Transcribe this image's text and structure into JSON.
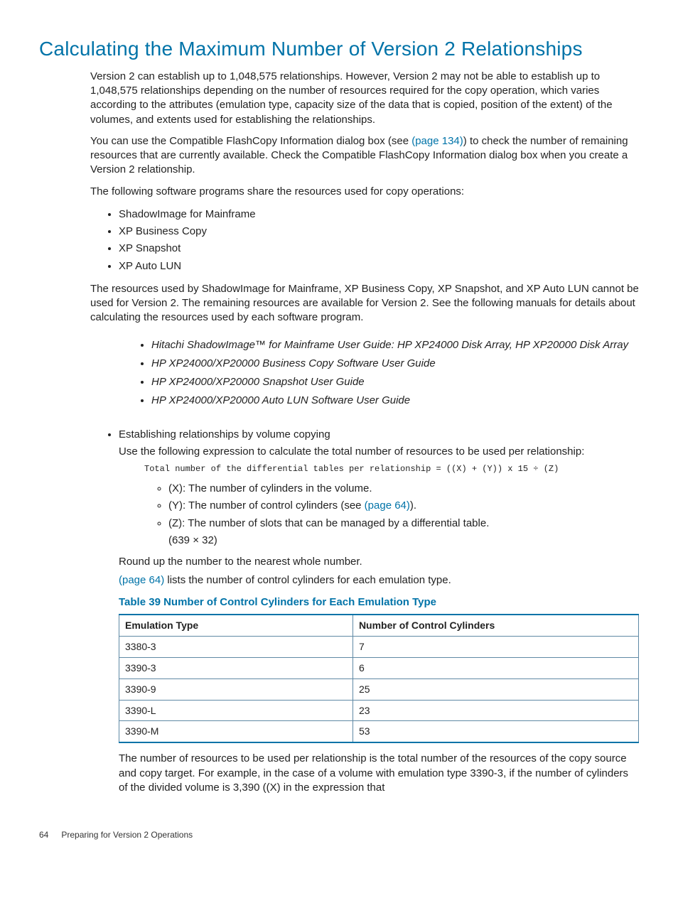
{
  "heading": "Calculating the Maximum Number of Version 2 Relationships",
  "p1": "Version 2 can establish up to 1,048,575 relationships. However, Version 2 may not be able to establish up to 1,048,575 relationships depending on the number of resources required for the copy operation, which varies according to the attributes (emulation type, capacity size of the data that is copied, position of the extent) of the volumes, and extents used for establishing the relationships.",
  "p2a": "You can use the Compatible FlashCopy Information dialog box (see ",
  "p2_link": "(page 134)",
  "p2b": ") to check the number of remaining resources that are currently available. Check the Compatible FlashCopy Information dialog box when you create a Version 2 relationship.",
  "p3": "The following software programs share the resources used for copy operations:",
  "bullets1": {
    "0": "ShadowImage for Mainframe",
    "1": "XP Business Copy",
    "2": "XP Snapshot",
    "3": "XP Auto LUN"
  },
  "p4": "The resources used by ShadowImage for Mainframe, XP Business Copy, XP Snapshot, and XP Auto LUN cannot be used for Version 2. The remaining resources are available for Version 2. See the following manuals for details about calculating the resources used by each software program.",
  "manuals": {
    "0": "Hitachi ShadowImage™ for Mainframe User Guide: HP XP24000 Disk Array, HP XP20000 Disk Array",
    "1": "HP XP24000/XP20000 Business Copy Software User Guide",
    "2": "HP XP24000/XP20000 Snapshot User Guide",
    "3": "HP XP24000/XP20000 Auto LUN Software User Guide"
  },
  "est_heading": "Establishing relationships by volume copying",
  "est_p1": "Use the following expression to calculate the total number of resources to be used per relationship:",
  "code_line": "Total number of the differential tables per relationship = ((X) + (Y)) x 15 ÷ (Z)",
  "defX": "(X): The number of cylinders in the volume.",
  "defY_a": "(Y): The number of control cylinders (see ",
  "defY_link": "(page 64)",
  "defY_b": ").",
  "defZ": "(Z): The number of slots that can be managed by a differential table.",
  "defZ_val": "(639 × 32)",
  "round": "Round up the number to the nearest whole number.",
  "p64_link": "(page 64)",
  "p64_rest": " lists the number of control cylinders for each emulation type.",
  "table_caption": "Table 39 Number of Control Cylinders for Each Emulation Type",
  "th1": "Emulation Type",
  "th2": "Number of Control Cylinders",
  "chart_data": {
    "type": "table",
    "columns": [
      "Emulation Type",
      "Number of Control Cylinders"
    ],
    "rows": [
      {
        "c0": "3380-3",
        "c1": "7"
      },
      {
        "c0": "3390-3",
        "c1": "6"
      },
      {
        "c0": "3390-9",
        "c1": "25"
      },
      {
        "c0": "3390-L",
        "c1": "23"
      },
      {
        "c0": "3390-M",
        "c1": "53"
      }
    ]
  },
  "p_after_table": "The number of resources to be used per relationship is the total number of the resources of the copy source and copy target. For example, in the case of a volume with emulation type 3390-3, if the number of cylinders of the divided volume is 3,390 ((X) in the expression that",
  "footer_page": "64",
  "footer_text": "Preparing for Version 2 Operations"
}
